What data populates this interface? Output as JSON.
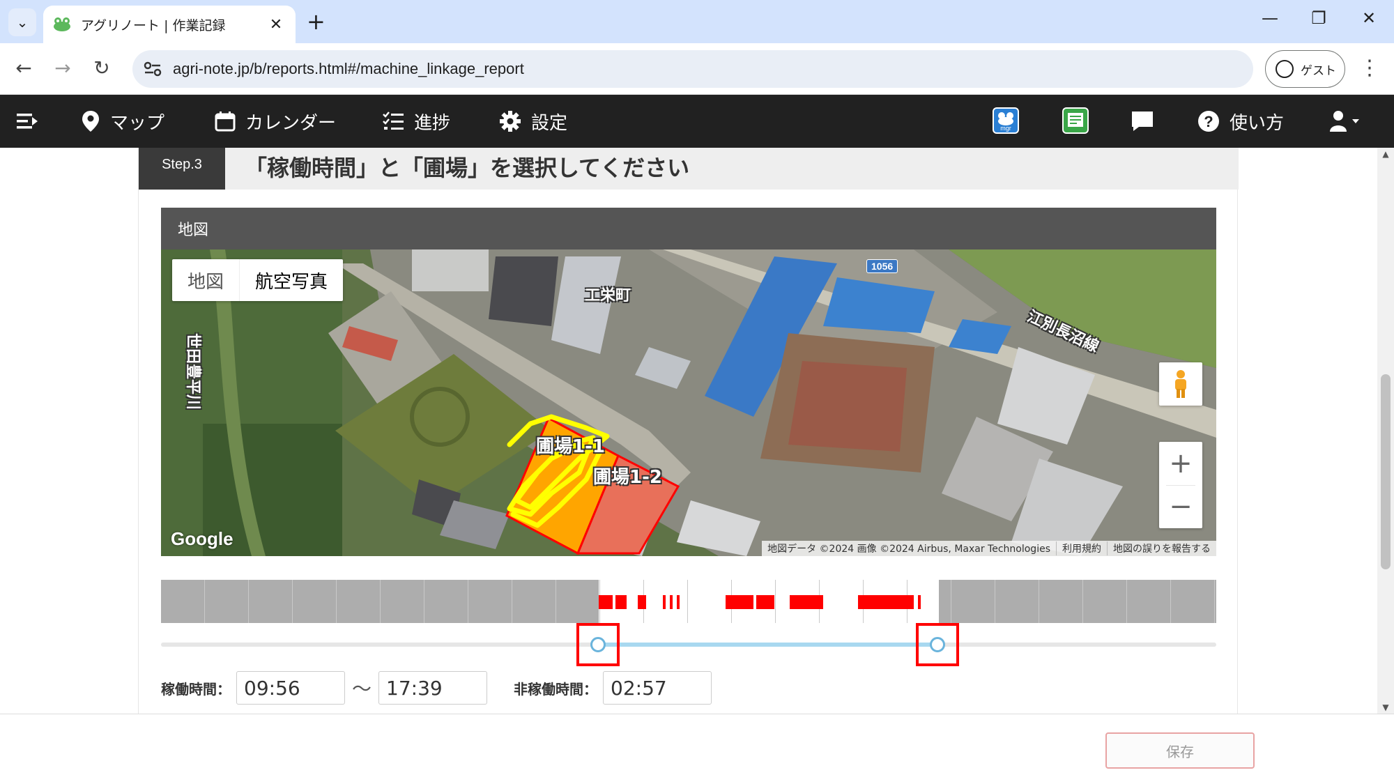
{
  "browser": {
    "tab_title": "アグリノート | 作業記録",
    "url": "agri-note.jp/b/reports.html#/machine_linkage_report",
    "profile_label": "ゲスト",
    "icons": [
      "tab-search-icon",
      "close-icon",
      "new-tab-icon",
      "minimize-icon",
      "restore-icon",
      "window-close-icon",
      "back-icon",
      "forward-icon",
      "reload-icon",
      "site-info-icon",
      "profile-icon",
      "more-icon"
    ]
  },
  "navbar": {
    "items": [
      {
        "label": "マップ",
        "icon": "map-pin-icon"
      },
      {
        "label": "カレンダー",
        "icon": "calendar-icon"
      },
      {
        "label": "進捗",
        "icon": "checklist-icon"
      },
      {
        "label": "設定",
        "icon": "gear-icon"
      }
    ],
    "help_label": "使い方",
    "badges": [
      {
        "text": "mgr",
        "color": "#2a7fd4"
      },
      {
        "text": "農業日誌",
        "color": "#3aa648"
      }
    ]
  },
  "step": {
    "label": "Step.3",
    "title": "「稼働時間」と「圃場」を選択してください"
  },
  "map": {
    "header": "地図",
    "type_buttons": [
      "地図",
      "航空写真"
    ],
    "active_type": "航空写真",
    "labels": {
      "district": "工栄町",
      "river": "世田豊平川",
      "road": "江別長沼線",
      "road_number": "1056",
      "field_1": "圃場1-1",
      "field_2": "圃場1-2"
    },
    "logo": "Google",
    "attribution": [
      "地図データ ©2024 画像 ©2024 Airbus, Maxar Technologies",
      "利用規約",
      "地図の誤りを報告する"
    ],
    "field_colors": {
      "selected": "#ffa500",
      "unselected": "#e8705a",
      "outline": "#ff0000",
      "track": "#ffff00"
    }
  },
  "timeline": {
    "active_color": "#ff0000",
    "start_fraction": 0.414,
    "end_fraction": 0.736
  },
  "work_time": {
    "label": "稼働時間：",
    "start": "09:56",
    "separator": "〜",
    "end": "17:39"
  },
  "idle_time": {
    "label": "非稼働時間：",
    "value": "02:57"
  },
  "footer": {
    "save_label": "保存"
  }
}
